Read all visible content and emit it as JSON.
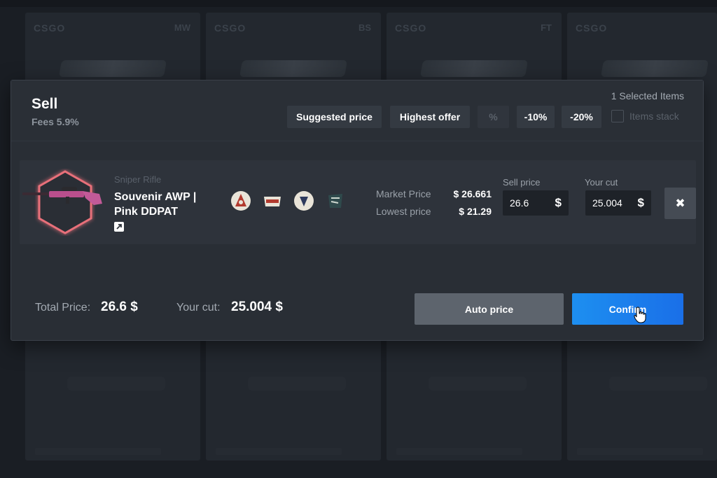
{
  "background_cards": [
    {
      "game": "CSGO",
      "wear": "MW"
    },
    {
      "game": "CSGO",
      "wear": "BS"
    },
    {
      "game": "CSGO",
      "wear": "FT"
    },
    {
      "game": "CSGO",
      "wear": ""
    }
  ],
  "modal": {
    "title": "Sell",
    "fees": "Fees 5.9%",
    "selected_items": "1 Selected Items",
    "buttons": {
      "suggested_price": "Suggested price",
      "highest_offer": "Highest offer",
      "percent": "%",
      "minus10": "-10%",
      "minus20": "-20%"
    },
    "items_stack": "Items stack"
  },
  "item": {
    "category": "Sniper Rifle",
    "name": "Souvenir AWP | Pink DDPAT",
    "market_price_label": "Market Price",
    "market_price_value": "$ 26.661",
    "lowest_price_label": "Lowest price",
    "lowest_price_value": "$ 21.29",
    "sell_price_label": "Sell price",
    "sell_price_value": "26.6",
    "your_cut_label": "Your cut",
    "your_cut_value": "25.004",
    "currency": "$",
    "remove": "✖"
  },
  "footer": {
    "total_price_label": "Total Price:",
    "total_price_value": "26.6 $",
    "your_cut_label": "Your cut:",
    "your_cut_value": "25.004 $",
    "auto_price": "Auto price",
    "confirm": "Confirm"
  },
  "colors": {
    "accent": "#1d8ff0",
    "hexagon_glow": "#e8707a",
    "panel": "#292e35",
    "background": "#1a1e24"
  },
  "icons": {
    "external_link": "external-link-icon",
    "remove": "close-icon",
    "cursor": "hand-cursor-icon"
  }
}
